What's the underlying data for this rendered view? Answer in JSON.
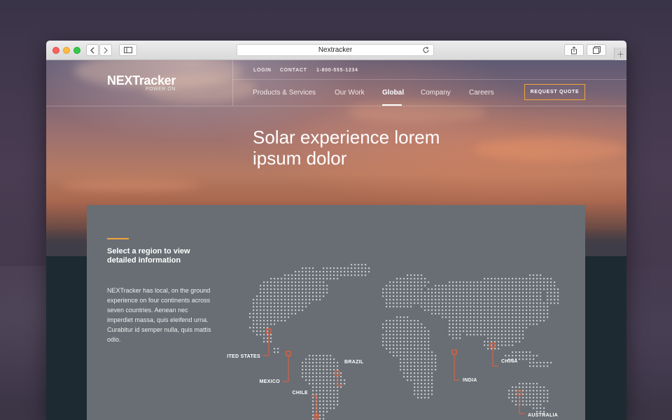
{
  "browser": {
    "url_text": "Nextracker",
    "icons": [
      "back-icon",
      "forward-icon",
      "sidebar-icon",
      "reload-icon",
      "share-icon",
      "tabs-icon",
      "plus-icon"
    ]
  },
  "header": {
    "logo": {
      "name": "NEXTracker",
      "tagline": "POWER ON."
    },
    "utility": {
      "login": "LOGIN",
      "contact": "CONTACT",
      "phone": "1-800-555-1234"
    },
    "nav": [
      {
        "label": "Products & Services",
        "active": false
      },
      {
        "label": "Our Work",
        "active": false
      },
      {
        "label": "Global",
        "active": true
      },
      {
        "label": "Company",
        "active": false
      },
      {
        "label": "Careers",
        "active": false
      }
    ],
    "cta": "REQUEST QUOTE"
  },
  "hero": {
    "headline": "Solar experience lorem ipsum dolor"
  },
  "regions": {
    "title": "Select a region to view detailed information",
    "body": "NEXTracker has local, on the ground experience on four continents across seven countries. Aenean nec imperdiet massa, quis eleifend urna. Curabitur id semper nulla, quis mattis odio.",
    "markers": [
      {
        "label": "UNITED STATES"
      },
      {
        "label": "MEXICO"
      },
      {
        "label": "BRAZIL"
      },
      {
        "label": "CHILE"
      },
      {
        "label": "INDIA"
      },
      {
        "label": "CHINA"
      },
      {
        "label": "AUSTRALIA"
      }
    ]
  },
  "colors": {
    "accent": "#f0a53b",
    "marker": "#e8603c",
    "panel": "#686e74",
    "map_dot": "#d9dcde"
  }
}
